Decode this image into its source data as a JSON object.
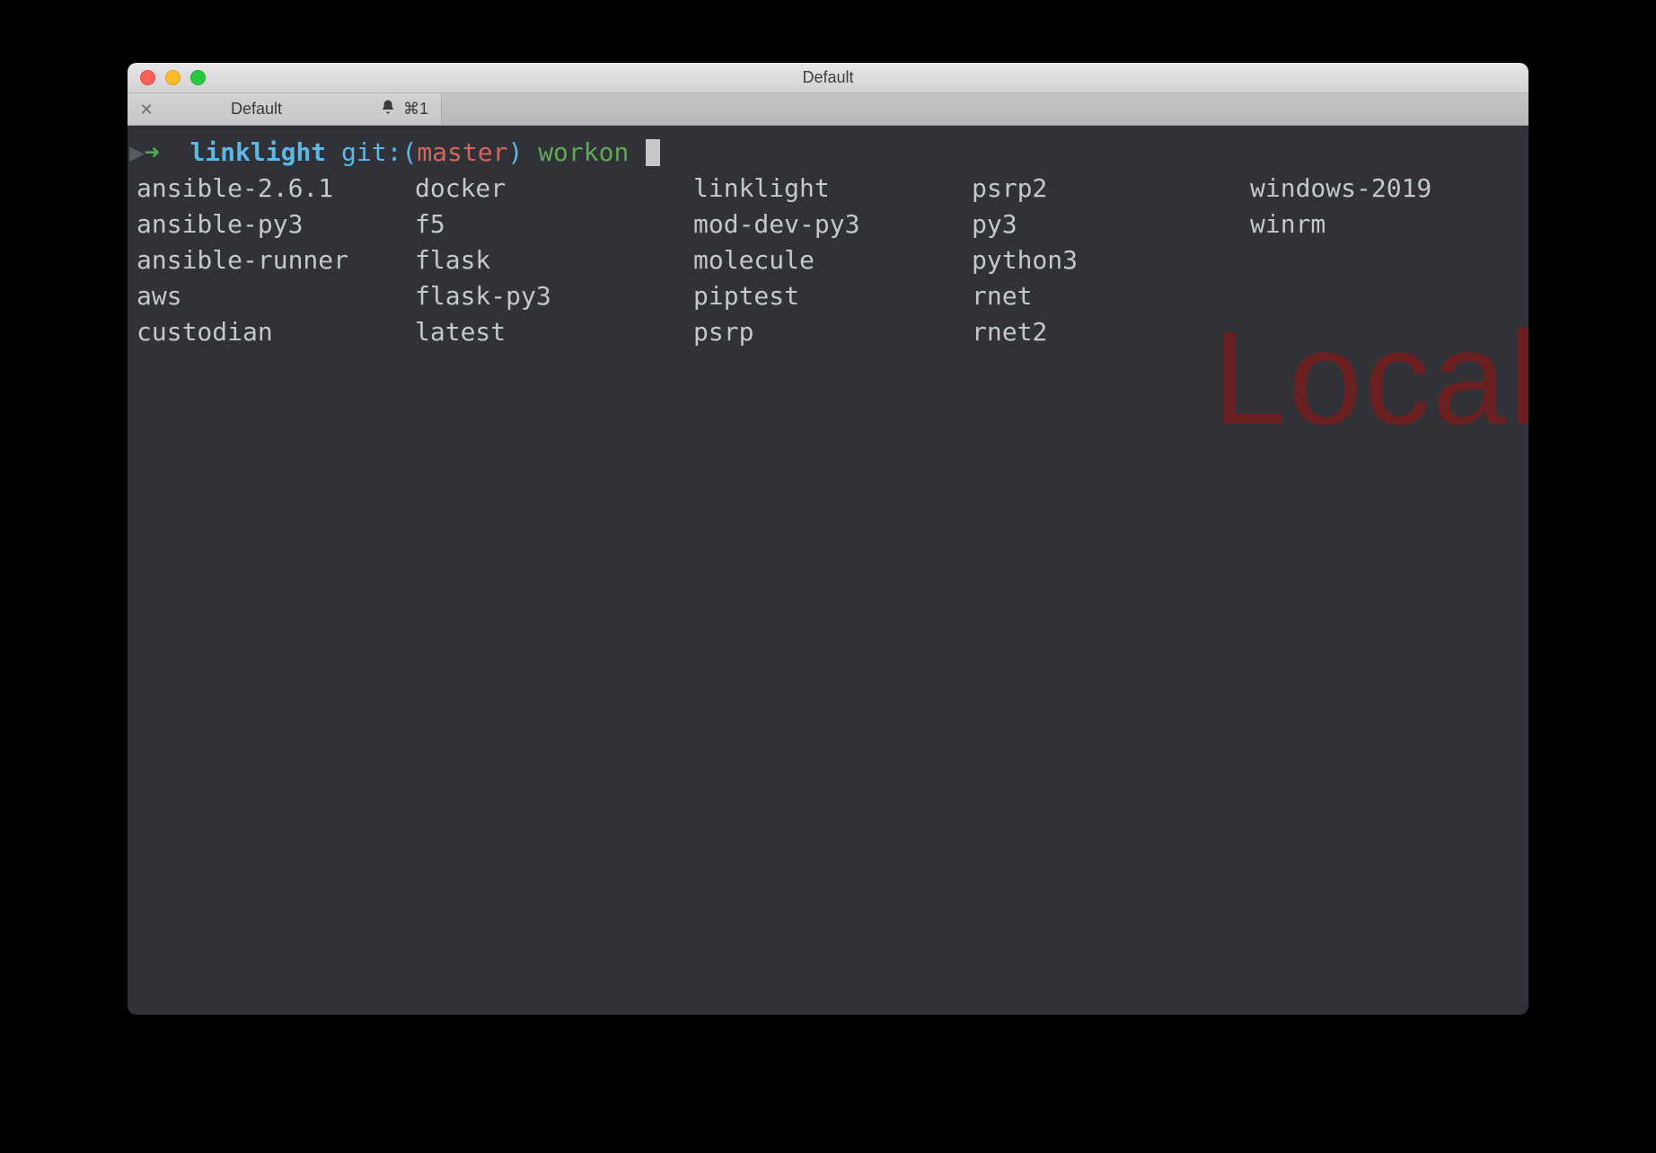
{
  "window": {
    "title": "Default"
  },
  "tab": {
    "title": "Default",
    "bell_icon": "🔔",
    "shortcut": "⌘1"
  },
  "prompt": {
    "arrow": "➜",
    "cwd": "linklight",
    "git_prefix": "git:",
    "open_paren": "(",
    "branch": "master",
    "close_paren": ")",
    "command": "workon"
  },
  "envs": {
    "col1": [
      "ansible-2.6.1",
      "ansible-py3",
      "ansible-runner",
      "aws",
      "custodian"
    ],
    "col2": [
      "docker",
      "f5",
      "flask",
      "flask-py3",
      "latest"
    ],
    "col3": [
      "linklight",
      "mod-dev-py3",
      "molecule",
      "piptest",
      "psrp"
    ],
    "col4": [
      "psrp2",
      "py3",
      "python3",
      "rnet",
      "rnet2"
    ],
    "col5": [
      "windows-2019",
      "winrm"
    ]
  },
  "watermark": "Local"
}
